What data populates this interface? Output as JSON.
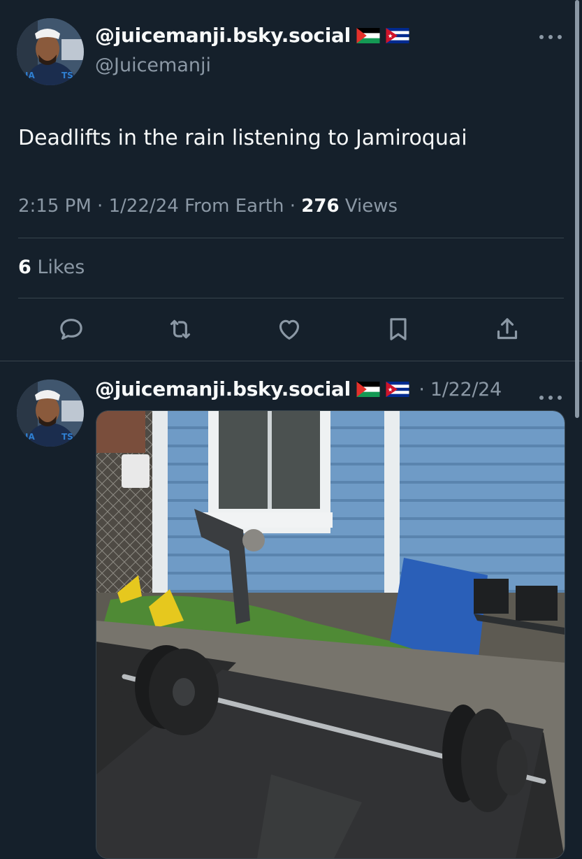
{
  "tweet": {
    "display_name": "@juicemanji.bsky.social",
    "handle": "@Juicemanji",
    "flags": [
      "palestine-flag-icon",
      "cuba-flag-icon"
    ],
    "text": "Deadlifts in the rain listening to Jamiroquai",
    "time": "2:15 PM",
    "sep1": "·",
    "date": "1/22/24",
    "source": "From Earth",
    "sep2": "·",
    "views_count": "276",
    "views_label": "Views",
    "likes_count": "6",
    "likes_label": "Likes",
    "actions": [
      "reply-icon",
      "retweet-icon",
      "like-icon",
      "bookmark-icon",
      "share-icon"
    ]
  },
  "reply": {
    "display_name": "@juicemanji.bsky.social",
    "flags": [
      "palestine-flag-icon",
      "cuba-flag-icon"
    ],
    "date": "· 1/22/24",
    "image": "outdoor-barbell-photo"
  },
  "colors": {
    "background": "#15202b",
    "text": "#f7f9f9",
    "muted": "#8b98a5",
    "divider": "#38444d"
  }
}
